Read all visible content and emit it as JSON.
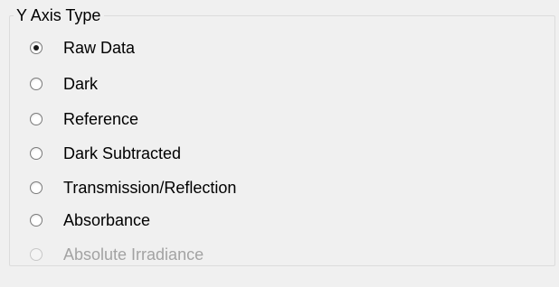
{
  "group": {
    "title": "Y Axis Type"
  },
  "options": [
    {
      "label": "Raw Data",
      "selected": true,
      "enabled": true
    },
    {
      "label": "Dark",
      "selected": false,
      "enabled": true
    },
    {
      "label": "Reference",
      "selected": false,
      "enabled": true
    },
    {
      "label": "Dark Subtracted",
      "selected": false,
      "enabled": true
    },
    {
      "label": "Transmission/Reflection",
      "selected": false,
      "enabled": true
    },
    {
      "label": "Absorbance",
      "selected": false,
      "enabled": true
    },
    {
      "label": "Absolute Irradiance",
      "selected": false,
      "enabled": false
    }
  ]
}
